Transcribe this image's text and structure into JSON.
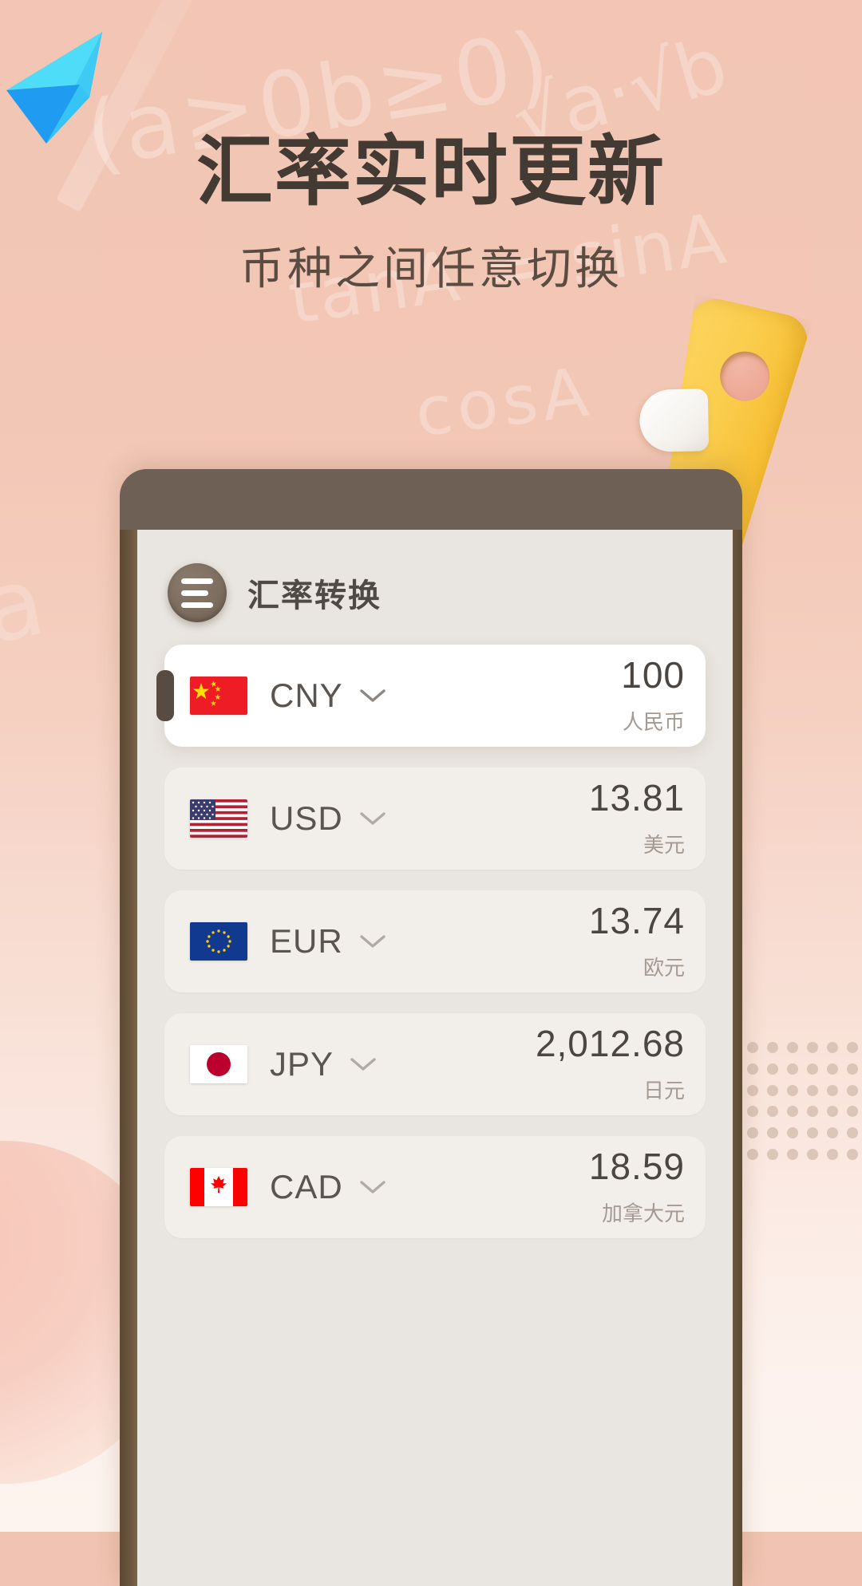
{
  "promo": {
    "headline": "汇率实时更新",
    "subhead": "币种之间任意切换",
    "logo_icon": "paper-plane-icon",
    "marker_icon": "yellow-highlighter-icon",
    "background_watermarks": [
      "(a≥0b≥0)",
      "√a·√b",
      "tanA = sinA",
      "cosA",
      "a",
      "A"
    ],
    "colors": {
      "background_top": "#f2c5b4",
      "background_bottom": "#fdf4ef",
      "headline": "#423a33",
      "subhead": "#5b4c42",
      "plane_light": "#4ddcf8",
      "plane_dark": "#1e9bf0",
      "marker_yellow": "#fbcd4d",
      "phone_frame": "#6e6054"
    }
  },
  "app": {
    "menu_icon": "hamburger-menu-icon",
    "title": "汇率转换",
    "rows": [
      {
        "flag": "cn-flag-icon",
        "code": "CNY",
        "chevron": "chevron-down-icon",
        "amount": "100",
        "name": "人民币",
        "active": true
      },
      {
        "flag": "us-flag-icon",
        "code": "USD",
        "chevron": "chevron-down-icon",
        "amount": "13.81",
        "name": "美元",
        "active": false
      },
      {
        "flag": "eu-flag-icon",
        "code": "EUR",
        "chevron": "chevron-down-icon",
        "amount": "13.74",
        "name": "欧元",
        "active": false
      },
      {
        "flag": "jp-flag-icon",
        "code": "JPY",
        "chevron": "chevron-down-icon",
        "amount": "2,012.68",
        "name": "日元",
        "active": false
      },
      {
        "flag": "ca-flag-icon",
        "code": "CAD",
        "chevron": "chevron-down-icon",
        "amount": "18.59",
        "name": "加拿大元",
        "active": false
      }
    ]
  }
}
